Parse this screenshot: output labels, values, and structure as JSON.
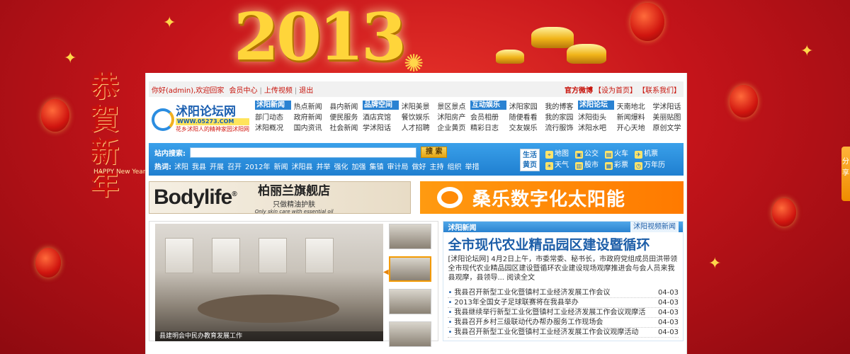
{
  "festival": {
    "year": "2013",
    "banner_text": "恭賀新年",
    "happy_text": "HAPPY New Year"
  },
  "topbar": {
    "greeting": "你好(admin),欢迎回家",
    "member_center": "会员中心",
    "upload_video": "上传视频",
    "logout": "退出",
    "weibo": "官方微博",
    "set_home": "【设为首页】",
    "contact": "【联系我们】"
  },
  "logo": {
    "name": "沭阳论坛网",
    "url": "WWW.05273.COM",
    "slogan": "花乡沭阳人的精神家园沭阳网"
  },
  "nav_groups": [
    {
      "tag": "沭阳新闻",
      "items": [
        "热点新闻",
        "县内新闻",
        "部门动态",
        "政府新闻",
        "便民服务",
        "沭阳概况",
        "国内资讯",
        "社会新闻"
      ]
    },
    {
      "tag": "品牌空间",
      "items": [
        "沭阳美景",
        "景区景点",
        "酒店宾馆",
        "餐饮娱乐",
        "沭阳房产",
        "学沭阳话",
        "人才招聘",
        "企业黄页"
      ]
    },
    {
      "tag": "互动娱乐",
      "items": [
        "沭阳家园",
        "我的博客",
        "会员相册",
        "随便看看",
        "我的家园",
        "精彩日志",
        "交友娱乐",
        "流行服饰"
      ]
    },
    {
      "tag": "沭阳论坛",
      "items": [
        "天南地北",
        "学沭阳话",
        "沭阳街头",
        "新闻爆料",
        "美丽贴图",
        "沭阳水吧",
        "开心天地",
        "原创文学"
      ]
    }
  ],
  "search": {
    "label": "站内搜索:",
    "placeholder": "",
    "button": "搜 索",
    "hot_label": "热词:",
    "hot_words": [
      "沭阳",
      "我县",
      "开展",
      "召开",
      "2012年",
      "新闻",
      "沭阳县",
      "并举",
      "强化",
      "加强",
      "集镇",
      "审计局",
      "做好",
      "主持",
      "组织",
      "举措"
    ]
  },
  "life": {
    "tag": "生活黄页",
    "services": [
      {
        "icon": "map-icon",
        "label": "地图"
      },
      {
        "icon": "bus-icon",
        "label": "公交"
      },
      {
        "icon": "train-icon",
        "label": "火车"
      },
      {
        "icon": "plane-icon",
        "label": "机票"
      },
      {
        "icon": "weather-icon",
        "label": "天气"
      },
      {
        "icon": "stock-icon",
        "label": "股市"
      },
      {
        "icon": "lottery-icon",
        "label": "彩票"
      },
      {
        "icon": "calendar-icon",
        "label": "万年历"
      }
    ]
  },
  "ads": {
    "ad1_brand": "Bodylife",
    "ad1_mark": "®",
    "ad1_title": "柏丽兰旗舰店",
    "ad1_sub": "只做精油护肤",
    "ad1_en": "Only skin care with essential oil",
    "ad2_text": "桑乐数字化太阳能"
  },
  "slider": {
    "caption": "县建明会中民办教育发展工作"
  },
  "news": {
    "section": "沭阳新闻",
    "more": "沭阳视频新闻",
    "headline": "全市现代农业精品园区建设暨循环",
    "summary": "[沭阳论坛网] 4月2日上午，市委常委、秘书长，市政府党组成员田洪带领全市现代农业精品园区建设暨循环农业建设现场观摩推进会与会人员来我县观摩，县领导... 阅读全文",
    "read_all": "阅读全文",
    "items": [
      {
        "title": "我县召开新型工业化暨镇村工业经济发展工作会议",
        "date": "04-03"
      },
      {
        "title": "2013年全国女子足球联赛将在我县举办",
        "date": "04-03"
      },
      {
        "title": "我县继续举行新型工业化暨镇村工业经济发展工作会议观摩活",
        "date": "04-03"
      },
      {
        "title": "我县召开乡村三级联动代办帮办服务工作现场会",
        "date": "04-03"
      },
      {
        "title": "我县召开新型工业化暨镇村工业经济发展工作会议观摩活动",
        "date": "04-03"
      }
    ]
  },
  "side_tab": "分享"
}
